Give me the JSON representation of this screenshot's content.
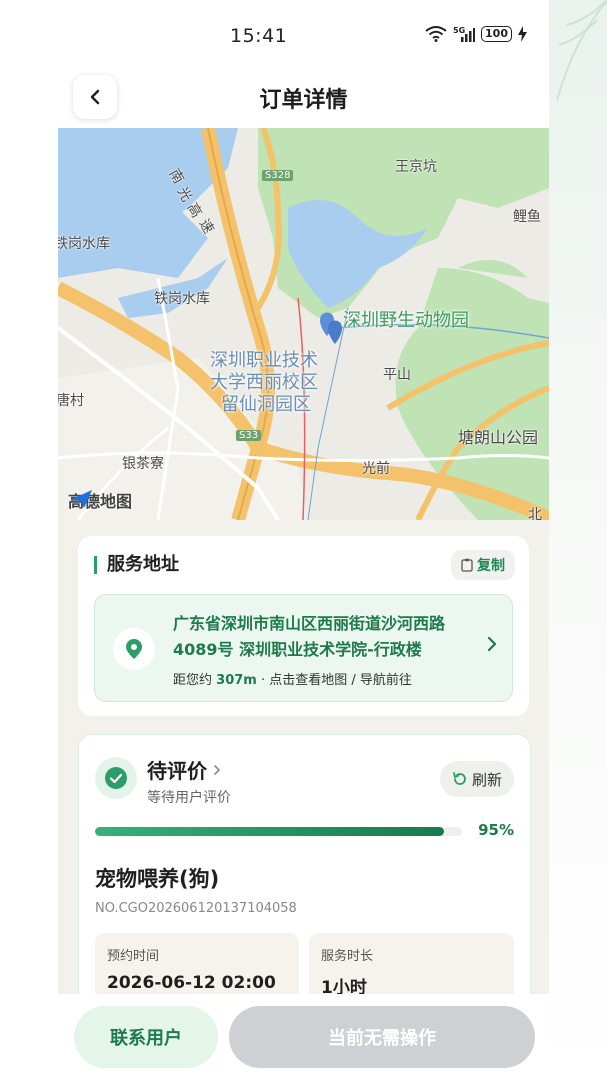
{
  "status_bar": {
    "time": "15:41",
    "wifi_label": "6",
    "network_label": "5G",
    "battery": "100"
  },
  "header": {
    "title": "订单详情",
    "back_icon": "chevron-left-icon"
  },
  "map": {
    "labels": {
      "wangjingkeng": "王京坑",
      "liyu": "鲤鱼",
      "tiegang_left": "铁岗水库",
      "tiegang": "铁岗水库",
      "nanguang_1": "南",
      "nanguang_2": "光",
      "nanguang_3": "高",
      "nanguang_4": "速",
      "s328": "S328",
      "zoo": "深圳野生动物园",
      "school_1": "深圳职业技术",
      "school_2": "大学西丽校区",
      "school_3": "留仙洞园区",
      "pingshan": "平山",
      "tangcun": "唐村",
      "s33": "S33",
      "tanglangshan": "塘朗山公园",
      "yincha": "银茶寮",
      "guangqian": "光前",
      "bei": "北"
    },
    "logo_text": "高德地图"
  },
  "address_section": {
    "title": "服务地址",
    "copy_label": "复制",
    "address": "广东省深圳市南山区西丽街道沙河西路4089号 深圳职业技术学院-行政楼",
    "distance_prefix": "距您约",
    "distance": "307m",
    "hint": "· 点击查看地图 / 导航前往"
  },
  "order": {
    "status": "待评价",
    "status_sub": "等待用户评价",
    "refresh_label": "刷新",
    "progress": 95,
    "progress_label": "95%",
    "service_name": "宠物喂养(狗)",
    "order_no": "NO.CGO20260612013710405​8",
    "order_no_clean": "NO.CGO202606120137104058",
    "appointment_label": "预约时间",
    "appointment_value": "2026-06-12 02:00",
    "duration_label": "服务时长",
    "duration_value": "1小时"
  },
  "bottom": {
    "contact_label": "联系用户",
    "action_label": "当前无需操作"
  },
  "colors": {
    "accent": "#1d7a4c",
    "accent_light": "#e4f5ea",
    "disabled": "#cfd0d3"
  }
}
